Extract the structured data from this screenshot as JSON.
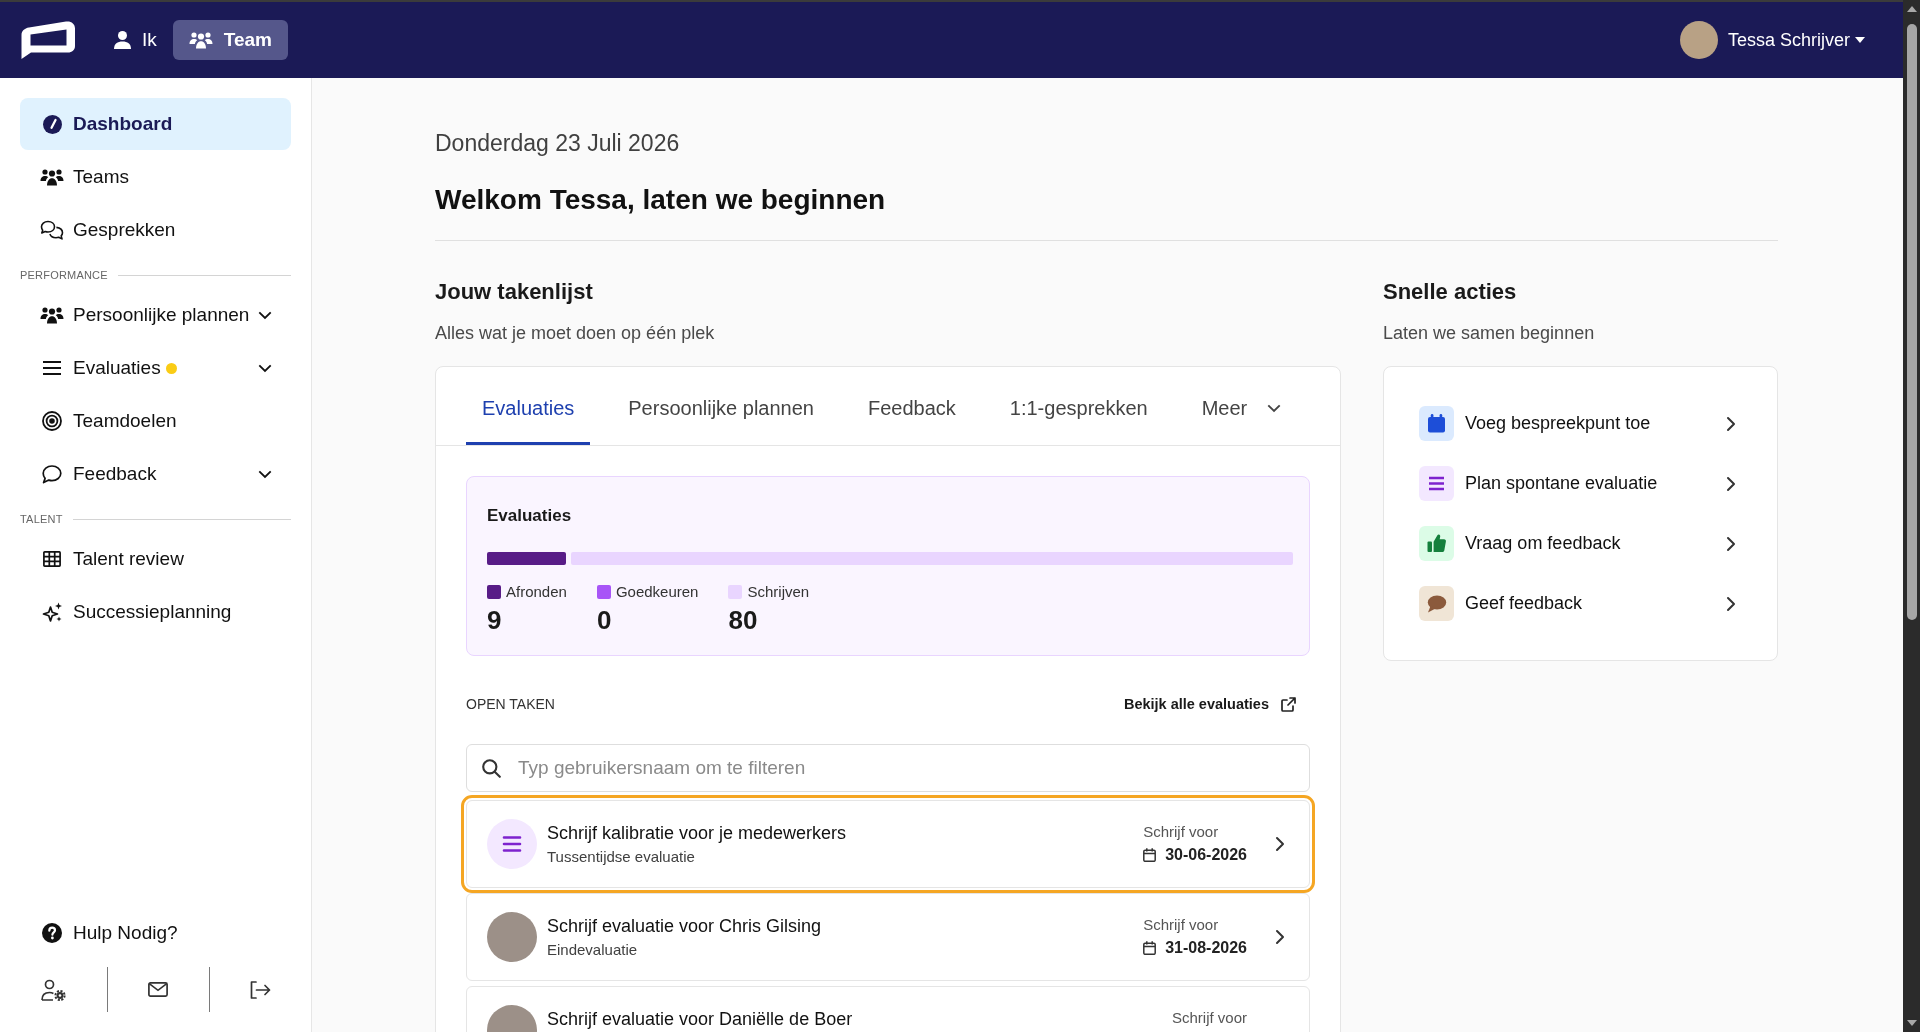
{
  "top_nav": [
    {
      "label": "Ik",
      "selected": false
    },
    {
      "label": "Team",
      "selected": true
    }
  ],
  "user_menu": {
    "name": "Tessa Schrijver"
  },
  "sidebar": {
    "sections": [
      {
        "items": [
          {
            "label": "Dashboard",
            "kind": "link",
            "selected": true,
            "notification": false
          },
          {
            "label": "Teams",
            "kind": "link",
            "selected": false,
            "notification": false
          },
          {
            "label": "Gesprekken",
            "kind": "link",
            "selected": false,
            "notification": false
          }
        ]
      },
      {
        "heading": "PERFORMANCE",
        "items": [
          {
            "label": "Persoonlijke plannen",
            "kind": "group",
            "expanded": false,
            "selected": false,
            "notification": false
          },
          {
            "label": "Evaluaties",
            "kind": "group",
            "expanded": false,
            "selected": false,
            "notification": true
          },
          {
            "label": "Teamdoelen",
            "kind": "link",
            "selected": false,
            "notification": false
          },
          {
            "label": "Feedback",
            "kind": "group",
            "expanded": false,
            "selected": false,
            "notification": false
          }
        ]
      },
      {
        "heading": "TALENT",
        "items": [
          {
            "label": "Talent review",
            "kind": "link",
            "selected": false,
            "notification": false
          },
          {
            "label": "Successieplanning",
            "kind": "link",
            "selected": false,
            "notification": false
          }
        ]
      }
    ],
    "help": {
      "label": "Hulp Nodig?"
    }
  },
  "dashboard": {
    "date": "Donderdag 23 Juli 2026",
    "greeting": "Welkom Tessa, laten we beginnen"
  },
  "task_list": {
    "title": "Jouw takenlijst",
    "subtitle": "Alles wat je moet doen op één plek",
    "tabs": [
      {
        "label": "Evaluaties",
        "kind": "tab",
        "selected": true
      },
      {
        "label": "Persoonlijke plannen",
        "kind": "tab",
        "selected": false
      },
      {
        "label": "Feedback",
        "kind": "tab",
        "selected": false
      },
      {
        "label": "1:1-gesprekken",
        "kind": "tab",
        "selected": false
      },
      {
        "label": "Meer",
        "kind": "dropdown",
        "selected": false
      }
    ],
    "summary": {
      "title": "Evaluaties",
      "segments": [
        {
          "label": "Afronden",
          "count": "9",
          "level": 0.101,
          "color": "#581c87"
        },
        {
          "label": "Goedkeuren",
          "count": "0",
          "level": 0,
          "color": "#a855f7"
        },
        {
          "label": "Schrijven",
          "count": "80",
          "level": 0.899,
          "color": "#e9d5ff"
        }
      ]
    },
    "open_tasks": {
      "heading": "OPEN TAKEN",
      "link": "Bekijk alle evaluaties",
      "search": {
        "placeholder": "Typ gebruikersnaam om te filteren"
      },
      "tasks": [
        {
          "kind": "icon",
          "title": "Schrijf kalibratie voor je medewerkers",
          "subtitle": "Tussentijdse evaluatie",
          "due_label": "Schrijf voor",
          "due_date": "30-06-2026",
          "highlighted": true
        },
        {
          "kind": "photo",
          "title": "Schrijf evaluatie voor Chris Gilsing",
          "subtitle": "Eindevaluatie",
          "due_label": "Schrijf voor",
          "due_date": "31-08-2026",
          "highlighted": false
        },
        {
          "kind": "photo",
          "title": "Schrijf evaluatie voor Daniëlle de Boer",
          "due_label": "Schrijf voor",
          "highlighted": false
        }
      ]
    }
  },
  "quick_actions": {
    "title": "Snelle acties",
    "subtitle": "Laten we samen beginnen",
    "items": [
      {
        "label": "Voeg bespreekpunt toe"
      },
      {
        "label": "Plan spontane evaluatie"
      },
      {
        "label": "Vraag om feedback"
      },
      {
        "label": "Geef feedback"
      }
    ]
  }
}
